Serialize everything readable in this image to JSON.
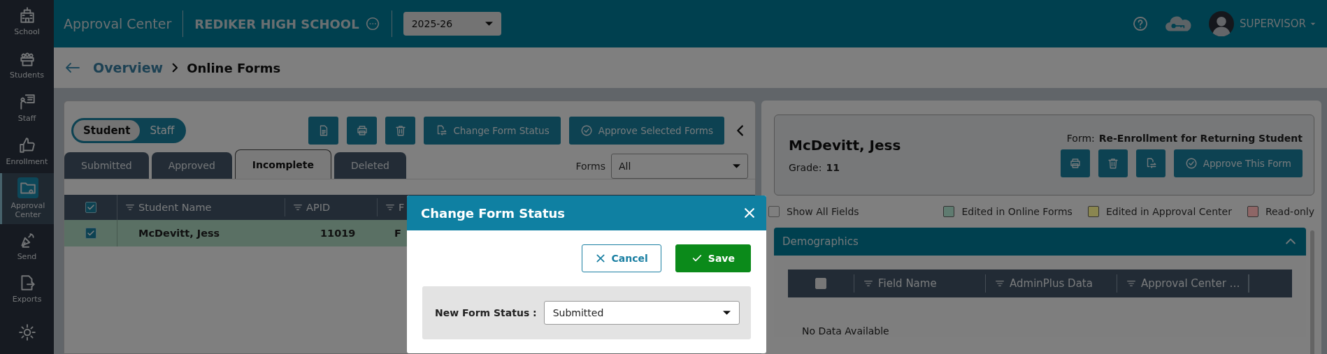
{
  "sidebar": {
    "items": [
      {
        "label": "School",
        "selected": false
      },
      {
        "label": "Students",
        "selected": false
      },
      {
        "label": "Staff",
        "selected": false
      },
      {
        "label": "Enrollment",
        "selected": false
      },
      {
        "label": "Approval Center",
        "selected": true
      },
      {
        "label": "Send",
        "selected": false
      },
      {
        "label": "Exports",
        "selected": false
      },
      {
        "selected": false
      }
    ]
  },
  "header": {
    "title": "Approval Center",
    "school": "REDIKER HIGH SCHOOL",
    "year": "2025-26",
    "user": "SUPERVISOR"
  },
  "breadcrumb": {
    "parent": "Overview",
    "current": "Online Forms"
  },
  "left_panel": {
    "toggle": [
      {
        "label": "Student",
        "selected": true
      },
      {
        "label": "Staff",
        "selected": false
      }
    ],
    "toolbar": [
      {
        "kind": "document"
      },
      {
        "kind": "print"
      },
      {
        "kind": "trash"
      },
      {
        "kind": "status",
        "label": "Change Form Status"
      },
      {
        "kind": "check",
        "label": "Approve Selected Forms"
      }
    ],
    "tabs": [
      {
        "label": "Submitted",
        "selected": false
      },
      {
        "label": "Approved",
        "selected": false
      },
      {
        "label": "Incomplete",
        "selected": true
      },
      {
        "label": "Deleted",
        "selected": false
      }
    ],
    "forms_filter": {
      "label": "Forms",
      "value": "All"
    },
    "table": {
      "select_all_checked": true,
      "columns": [
        "Student Name",
        "APID",
        "F"
      ],
      "rows": [
        {
          "checked": true,
          "selected": true,
          "cells": [
            "McDevitt, Jess",
            "11019",
            "F"
          ]
        }
      ]
    }
  },
  "right_panel": {
    "student": "McDevitt, Jess",
    "grade_label": "Grade:",
    "grade": "11",
    "form_label": "Form:",
    "form": "Re-Enrollment for Returning Student",
    "actions": [
      {
        "kind": "print"
      },
      {
        "kind": "trash"
      },
      {
        "kind": "status"
      },
      {
        "kind": "check",
        "label": "Approve This Form"
      }
    ],
    "show_all_fields": {
      "label": "Show All Fields",
      "checked": false
    },
    "legend": [
      {
        "label": "Edited in Online Forms",
        "color": "#5f7b70"
      },
      {
        "label": "Edited in Approval Center",
        "color": "#8a8650"
      },
      {
        "label": "Read-only",
        "color": "#8e6666"
      }
    ],
    "section": {
      "title": "Demographics",
      "expanded": true,
      "select_all_checked": false,
      "columns": [
        "Field Name",
        "AdminPlus Data",
        "Approval Center …"
      ],
      "empty_text": "No Data Available"
    }
  },
  "dialog": {
    "title": "Change Form Status",
    "buttons": [
      {
        "kind": "cancel",
        "label": "Cancel"
      },
      {
        "kind": "save",
        "label": "Save"
      }
    ],
    "field_label": "New Form Status :",
    "value": "Submitted"
  }
}
